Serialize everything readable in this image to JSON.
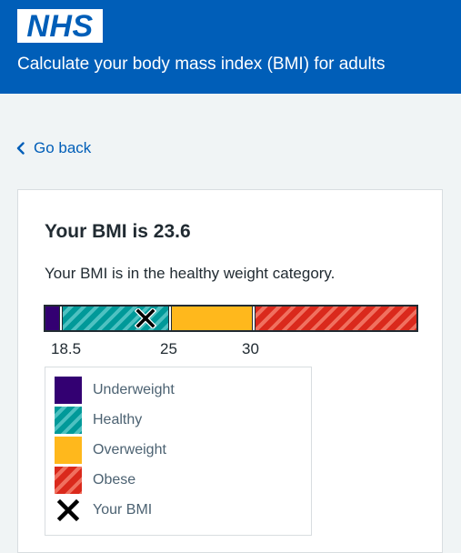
{
  "header": {
    "logo_text": "NHS",
    "title": "Calculate your body mass index (BMI) for adults"
  },
  "nav": {
    "back_label": "Go back"
  },
  "result": {
    "title": "Your BMI is 23.6",
    "description": "Your BMI is in the healthy weight category.",
    "bmi_value": 23.6
  },
  "scale": {
    "thresholds": [
      "18.5",
      "25",
      "30"
    ],
    "min": 17,
    "max": 40
  },
  "legend": {
    "items": [
      {
        "label": "Underweight",
        "color": "#330072"
      },
      {
        "label": "Healthy",
        "color": "#009999"
      },
      {
        "label": "Overweight",
        "color": "#ffb81c"
      },
      {
        "label": "Obese",
        "color": "#da291c"
      },
      {
        "label": "Your BMI",
        "icon": "cross-marker-icon"
      }
    ]
  },
  "colors": {
    "brand": "#005eb8",
    "text": "#212b32",
    "background": "#f0f4f5"
  }
}
